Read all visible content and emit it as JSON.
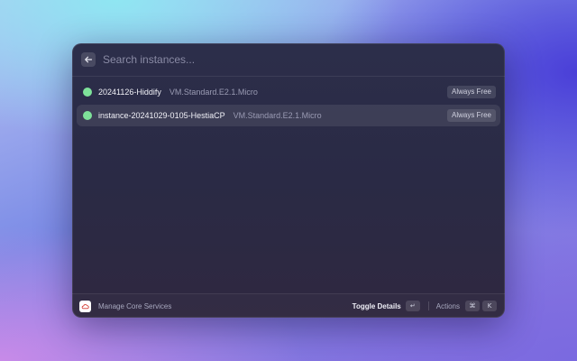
{
  "search": {
    "placeholder": "Search instances...",
    "value": ""
  },
  "instances": [
    {
      "name": "20241126-Hiddify",
      "shape": "VM.Standard.E2.1.Micro",
      "tag": "Always Free",
      "status_color": "#7ee29a"
    },
    {
      "name": "instance-20241029-0105-HestiaCP",
      "shape": "VM.Standard.E2.1.Micro",
      "tag": "Always Free",
      "status_color": "#7ee29a",
      "selected": true
    }
  ],
  "footer": {
    "command_label": "Manage Core Services",
    "app_icon": "cloud-icon",
    "primary_action": "Toggle Details",
    "primary_shortcut": "↵",
    "secondary_action": "Actions",
    "secondary_shortcut_keys": [
      "⌘",
      "K"
    ]
  },
  "icons": {
    "back": "arrow-left-icon"
  }
}
